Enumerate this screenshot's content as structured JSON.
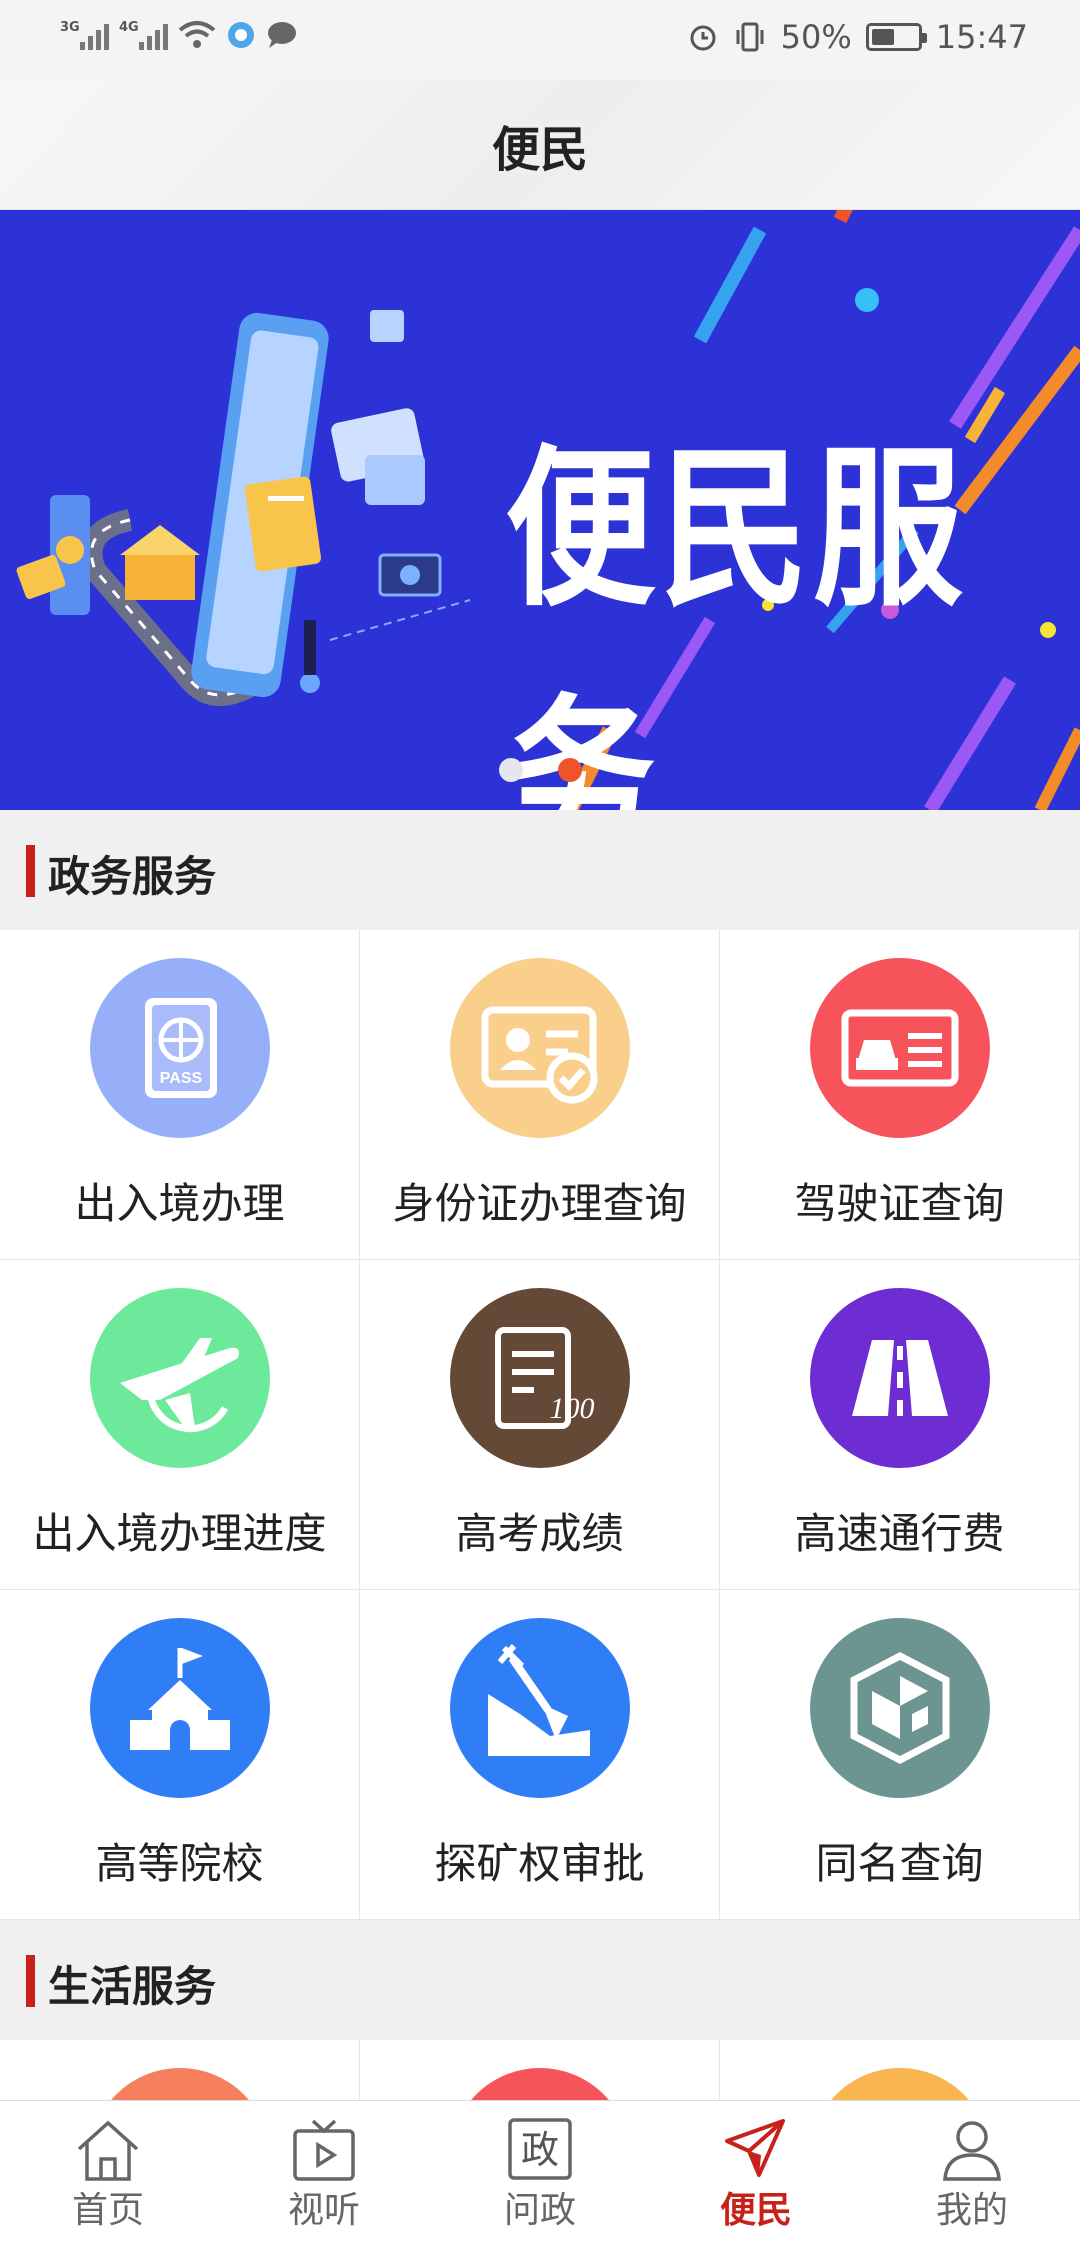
{
  "status_bar": {
    "sig1": "3G",
    "sig2": "4G",
    "battery_pct": "50%",
    "time": "15:47",
    "battery_level": 0.5
  },
  "header": {
    "title": "便民"
  },
  "banner": {
    "headline": "便民服务",
    "pages": 2,
    "active_page": 2
  },
  "sections": {
    "gov": {
      "title": "政务服务"
    },
    "life": {
      "title": "生活服务"
    }
  },
  "services": [
    {
      "label": "出入境办理",
      "icon": "passport-icon",
      "color": "#97aef9"
    },
    {
      "label": "身份证办理查询",
      "icon": "id-card-check-icon",
      "color": "#f9cf8b"
    },
    {
      "label": "驾驶证查询",
      "icon": "driver-license-icon",
      "color": "#f6545a"
    },
    {
      "label": "出入境办理进度",
      "icon": "airplane-globe-icon",
      "color": "#6ce99b"
    },
    {
      "label": "高考成绩",
      "icon": "score-sheet-icon",
      "color": "#644936"
    },
    {
      "label": "高速通行费",
      "icon": "highway-icon",
      "color": "#6d2dd3"
    },
    {
      "label": "高等院校",
      "icon": "school-icon",
      "color": "#2f7ef5"
    },
    {
      "label": "探矿权审批",
      "icon": "shovel-icon",
      "color": "#2f7ef5"
    },
    {
      "label": "同名查询",
      "icon": "shield-cube-icon",
      "color": "#6c9591"
    }
  ],
  "life_partial_colors": [
    "#f57e5c",
    "#f6545a",
    "#f9b54f"
  ],
  "nav": [
    {
      "label": "首页",
      "icon": "home-icon",
      "active": false
    },
    {
      "label": "视听",
      "icon": "tv-icon",
      "active": false
    },
    {
      "label": "问政",
      "icon": "zheng-box-icon",
      "glyph": "政",
      "active": false
    },
    {
      "label": "便民",
      "icon": "paper-plane-icon",
      "active": true
    },
    {
      "label": "我的",
      "icon": "profile-icon",
      "active": false
    }
  ],
  "colors": {
    "accent": "#c8211a",
    "banner_bg": "#2c32d6"
  }
}
